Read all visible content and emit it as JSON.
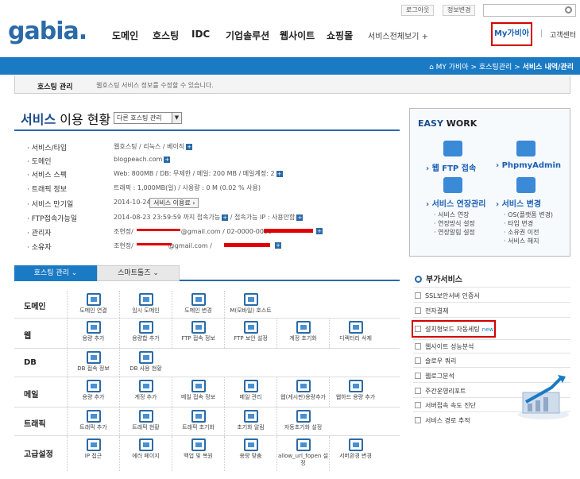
{
  "header": {
    "logo": "gabia.",
    "util": {
      "logout": "로그아웃",
      "profile": "정보변경"
    },
    "gnb": [
      "도메인",
      "호스팅",
      "IDC",
      "기업솔루션",
      "웹사이트",
      "쇼핑몰"
    ],
    "all_services": "서비스전체보기 +",
    "my_gabia": "My가비아",
    "customer_center": "고객센터"
  },
  "breadcrumb": {
    "home": "MY 가비아",
    "sep1": ">",
    "level2": "호스팅관리",
    "sep2": ">",
    "current": "서비스 내역/관리"
  },
  "subheader": {
    "title": "호스팅 관리",
    "desc": "웹호스팅 서비스 정보를 수정할 수 있습니다."
  },
  "service": {
    "title_main": "서비스",
    "title_rest": " 이용 현황",
    "select_value": "다른 호스팅 관리",
    "info": [
      {
        "label": "· 서비스/타입",
        "value": "웹호스팅 / 리눅스 / 베이직"
      },
      {
        "label": "· 도메인",
        "value": "blogpeach.com"
      },
      {
        "label": "· 서비스 스펙",
        "value": "Web: 800MB / DB: 무제한 / 메일: 200 MB / 메일계정: 2"
      },
      {
        "label": "· 트래픽 정보",
        "value": "트래픽 : 1,000MB(일) / 사용량 : 0 M (0.02 % 사용)"
      },
      {
        "label": "· 서비스 만기일",
        "value": "2014-10-24"
      },
      {
        "label": "· FTP접속가능일",
        "value": "2014-08-23 23:59:59 까지 접속가능"
      },
      {
        "label": "· 관리자",
        "value": "조현정/"
      },
      {
        "label": "· 소유자",
        "value": "조현정/"
      }
    ],
    "extend_button": "서비스 이용료 ›",
    "ftp_extra": "/ 접속가능 IP : 사용안함",
    "admin_tail": "@gmail.com / 02-0000-0000",
    "owner_tail": "@gmail.com /"
  },
  "tabs": {
    "hosting": "호스팅 관리 ⌄",
    "smart": "스마트툴즈 ⌄"
  },
  "grid": {
    "rows": [
      {
        "label": "도메인",
        "items": [
          "도메인 연결",
          "임시 도메인",
          "도메인 변경",
          "M(모바일) 호스트"
        ]
      },
      {
        "label": "웹",
        "items": [
          "용량 추가",
          "용량합 추가",
          "FTP 접속 정보",
          "FTP 보안 설정",
          "계정 초기화",
          "디렉터리 삭제"
        ]
      },
      {
        "label": "DB",
        "items": [
          "DB 접속 정보",
          "DB 사용 현황"
        ]
      },
      {
        "label": "메일",
        "items": [
          "용량 추가",
          "계정 추가",
          "메일 접속 정보",
          "메일 관리",
          "웹(게시판)용량추가",
          "웹하드 용량 추가"
        ]
      },
      {
        "label": "트래픽",
        "items": [
          "트래픽 추가",
          "트래픽 현황",
          "트래픽 초기화",
          "초기화 알림",
          "자동초기화 설정"
        ]
      },
      {
        "label": "고급설정",
        "items": [
          "IP 접근",
          "에러 페이지",
          "백업 및 복원",
          "용량 맞춤",
          "allow_url_fopen 설정",
          "서버환경 변경"
        ]
      }
    ]
  },
  "easy_work": {
    "title_a": "EASY",
    "title_b": " WORK",
    "items": [
      "› 웹 FTP 접속",
      "› PhpmyAdmin",
      "› 서비스 연장관리",
      "› 서비스 변경"
    ],
    "extend_sub": [
      "· 서비스 연장",
      "· 연장방식 설정",
      "· 연장알림 설정"
    ],
    "change_sub": [
      "· OS(플랫폼 변경)",
      "· 타입 변경",
      "· 소유권 이전",
      "· 서비스 해지"
    ]
  },
  "addon": {
    "title": "부가서비스",
    "items": [
      "SSL보안서버 인증서",
      "전자결제",
      "설치형보드 자동세팅",
      "웹사이트 성능분석",
      "슬로우 쿼리",
      "웹로그분석",
      "주간운영리포트",
      "서버접속 속도 진단",
      "서비스 경로 추적"
    ],
    "new_label": "new"
  },
  "colors": {
    "brand_blue": "#1a7ac4",
    "highlight_red": "#d40000"
  }
}
